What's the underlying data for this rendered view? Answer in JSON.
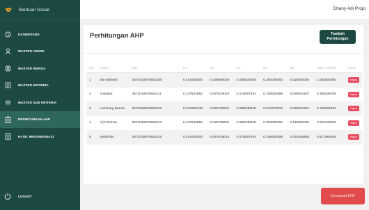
{
  "app": {
    "title": "Bantuan Sosial"
  },
  "sidebar": {
    "items": [
      {
        "label": "DASHBOARD",
        "icon": "clock-icon"
      },
      {
        "label": "MASTER USERS",
        "icon": "user-icon"
      },
      {
        "label": "MASTER WARGA",
        "icon": "user-circle-icon"
      },
      {
        "label": "MASTER KRITERIA",
        "icon": "list-icon"
      },
      {
        "label": "MASTER SUB KRITERIA",
        "icon": "gear-icon"
      },
      {
        "label": "PERHITUNGAN AHP",
        "icon": "clipboard-icon"
      },
      {
        "label": "HASIL REKOMENDASI",
        "icon": "document-icon"
      }
    ],
    "logout": "LOGOUT"
  },
  "header": {
    "user": "Dhany Adi Projo"
  },
  "main": {
    "title": "Perhitungan AHP",
    "add_button": "Tambah Perhitungan",
    "columns": [
      "NO",
      "NAMA",
      "NIK",
      "K1",
      "K2",
      "K3",
      "K4",
      "K5",
      "NILAI AKHIR",
      "AKSI"
    ],
    "rows": [
      {
        "no": "1",
        "nama": "Siti Halimah",
        "nik": "3573019876543209",
        "k1": "0.414000000",
        "k2": "0.159000000",
        "k3": "0.058000000",
        "k4": "0.260000000",
        "k5": "0.110000000",
        "nilai": "1.000000000",
        "aksi": "Hapus"
      },
      {
        "no": "2",
        "nama": "Yuliasari",
        "nik": "3573019876543211",
        "k1": "0.137623652",
        "k2": "0.057616023",
        "k3": "0.018087944",
        "k4": "0.106620599",
        "k5": "0.049091547",
        "nilai": "0.369039765",
        "aksi": "Hapus"
      },
      {
        "no": "3",
        "nama": "Lambang Basuki",
        "nik": "3573019876543212",
        "k1": "0.042299139",
        "k2": "0.020759231",
        "k3": "0.085049945",
        "k4": "0.043475976",
        "k5": "0.049091547",
        "nilai": "0.160675841",
        "aksi": "Hapus"
      },
      {
        "no": "4",
        "nama": "Aji Rohman",
        "nik": "3573019876543213",
        "k1": "0.137623652",
        "k2": "0.020759231",
        "k3": "0.085049945",
        "k4": "0.260000000",
        "k5": "0.110000000",
        "nilai": "0.533432826",
        "aksi": "Hapus"
      },
      {
        "no": "5",
        "nama": "Nurkholis",
        "nik": "3573019876543215",
        "k1": "0.414000000",
        "k2": "0.057616023",
        "k3": "0.018087944",
        "k4": "0.106620599",
        "k5": "0.021655893",
        "nilai": "0.617980459",
        "aksi": "Hapus"
      }
    ],
    "download_button": "Download PDF"
  },
  "colors": {
    "sidebar": "#1c4a43",
    "active": "#2f665d",
    "danger": "#e84a5f",
    "pdf": "#e14b4b"
  }
}
